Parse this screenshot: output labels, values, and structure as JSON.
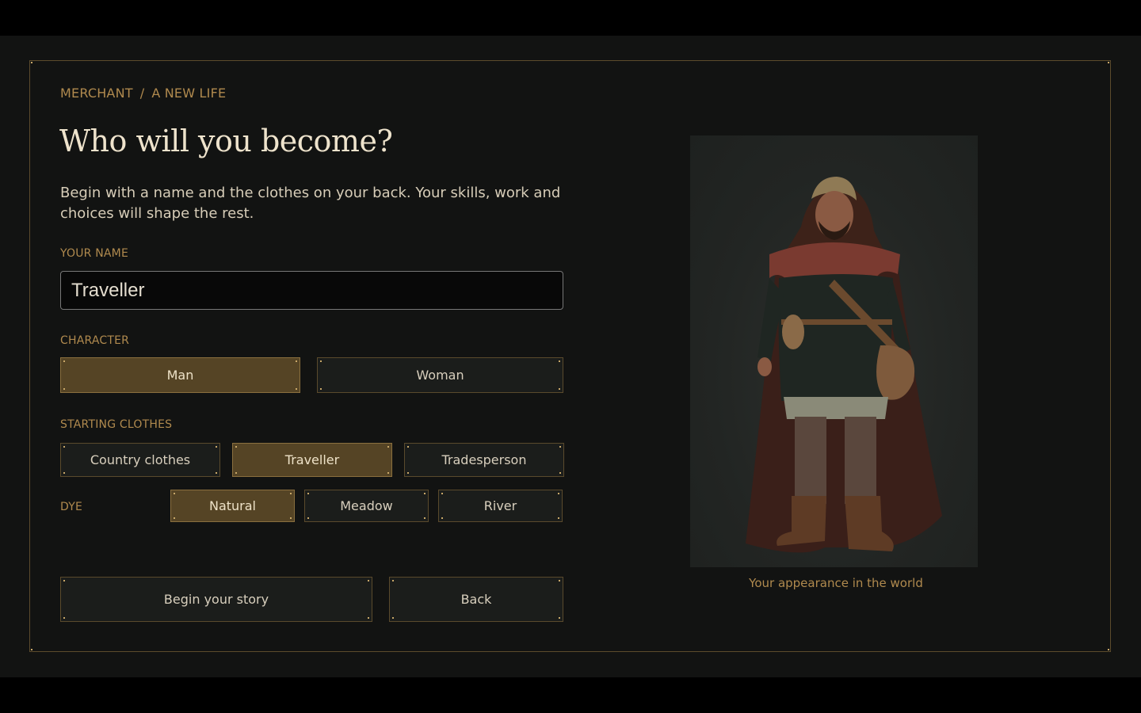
{
  "breadcrumb": {
    "role": "MERCHANT",
    "separator": "/",
    "step": "A NEW LIFE"
  },
  "title": "Who will you become?",
  "intro": "Begin with a name and the clothes on your back. Your skills, work and choices will shape the rest.",
  "name_field": {
    "label": "YOUR NAME",
    "value": "Traveller"
  },
  "character": {
    "label": "CHARACTER",
    "options": [
      "Man",
      "Woman"
    ],
    "selected": "Man"
  },
  "clothes": {
    "label": "STARTING CLOTHES",
    "options": [
      "Country clothes",
      "Traveller",
      "Tradesperson"
    ],
    "selected": "Traveller"
  },
  "dye": {
    "label": "DYE",
    "options": [
      "Natural",
      "Meadow",
      "River"
    ],
    "selected": "Natural"
  },
  "actions": {
    "begin_label": "Begin your story",
    "back_label": "Back"
  },
  "preview": {
    "caption": "Your appearance in the world",
    "figure": "merchant-character-model"
  },
  "colors": {
    "accent": "#b08a4e",
    "selected_bg": "#554425",
    "panel_bg": "#121312"
  }
}
